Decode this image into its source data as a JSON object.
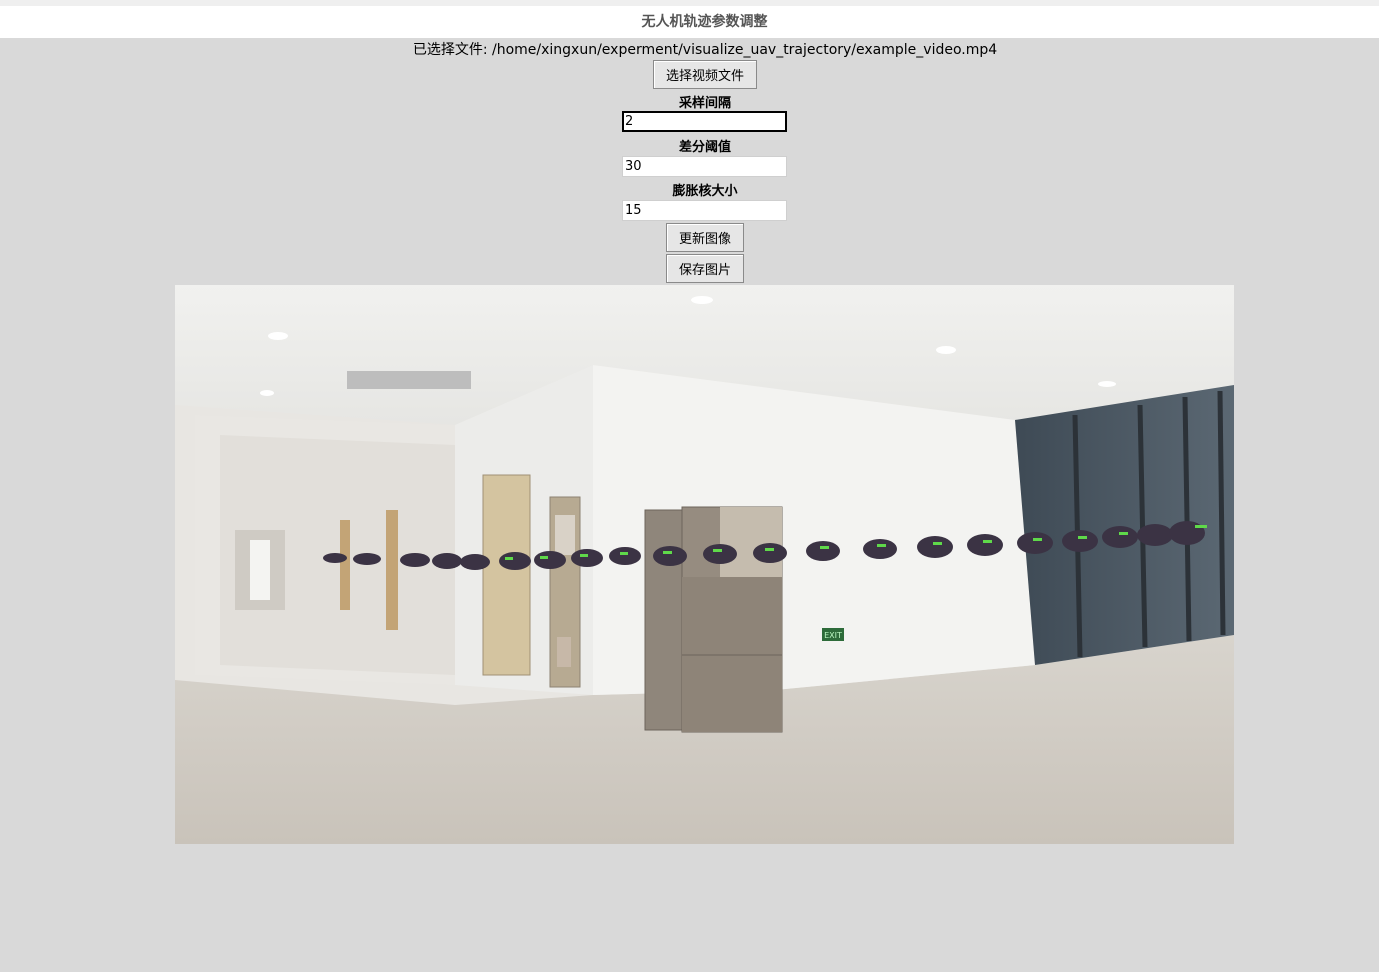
{
  "window": {
    "title": "无人机轨迹参数调整"
  },
  "file": {
    "selected_label": "已选择文件: /home/xingxun/experment/visualize_uav_trajectory/example_video.mp4"
  },
  "buttons": {
    "select_video": "选择视频文件",
    "update_image": "更新图像",
    "save_image": "保存图片"
  },
  "params": {
    "sample_interval": {
      "label": "采样间隔",
      "value": "2"
    },
    "diff_threshold": {
      "label": "差分阈值",
      "value": "30"
    },
    "dilate_kernel": {
      "label": "膨胀核大小",
      "value": "15"
    }
  },
  "preview": {
    "exit_sign_text": "EXIT"
  }
}
